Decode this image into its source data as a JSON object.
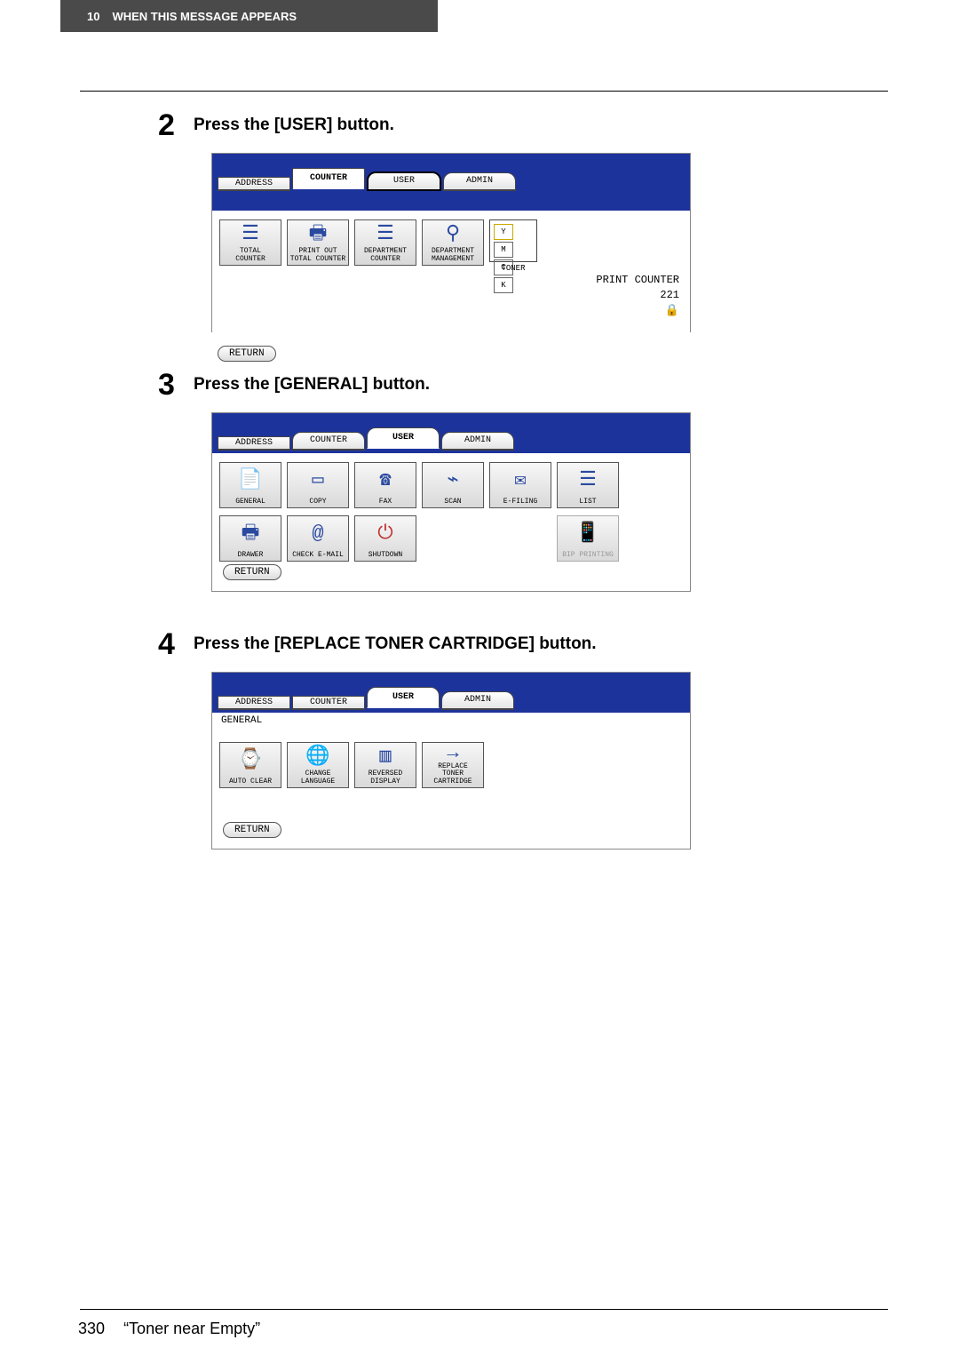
{
  "header": {
    "chapter_num": "10",
    "chapter_title": "WHEN THIS MESSAGE APPEARS"
  },
  "steps": [
    {
      "num": "2",
      "text": "Press the [USER] button."
    },
    {
      "num": "3",
      "text": "Press the [GENERAL] button."
    },
    {
      "num": "4",
      "text": "Press the [REPLACE TONER CARTRIDGE] button."
    }
  ],
  "shot1": {
    "tabs": {
      "address": "ADDRESS",
      "counter": "COUNTER",
      "user": "USER",
      "admin": "ADMIN"
    },
    "tiles": {
      "total_counter": "TOTAL\nCOUNTER",
      "print_out": "PRINT OUT\nTOTAL COUNTER",
      "dept_counter": "DEPARTMENT\nCOUNTER",
      "dept_mgmt": "DEPARTMENT\nMANAGEMENT",
      "toner": "TONER"
    },
    "toner_markers": {
      "y": "Y",
      "m": "M",
      "c": "C",
      "k": "K"
    },
    "print_counter_label": "PRINT COUNTER",
    "print_counter_value": "221",
    "return": "RETURN"
  },
  "shot2": {
    "tabs": {
      "address": "ADDRESS",
      "counter": "COUNTER",
      "user": "USER",
      "admin": "ADMIN"
    },
    "row1": {
      "general": "GENERAL",
      "copy": "COPY",
      "fax": "FAX",
      "scan": "SCAN",
      "efiling": "E-FILING",
      "list": "LIST"
    },
    "row2": {
      "drawer": "DRAWER",
      "check_email": "CHECK E-MAIL",
      "shutdown": "SHUTDOWN",
      "bip": "BIP PRINTING"
    },
    "return": "RETURN"
  },
  "shot3": {
    "tabs": {
      "address": "ADDRESS",
      "counter": "COUNTER",
      "user": "USER",
      "admin": "ADMIN"
    },
    "section": "GENERAL",
    "tiles": {
      "auto_clear": "AUTO CLEAR",
      "change_lang": "CHANGE\nLANGUAGE",
      "reversed": "REVERSED\nDISPLAY",
      "replace_toner": "REPLACE\nTONER\nCARTRIDGE"
    },
    "return": "RETURN"
  },
  "footer": {
    "page": "330",
    "title": "“Toner near Empty”"
  }
}
